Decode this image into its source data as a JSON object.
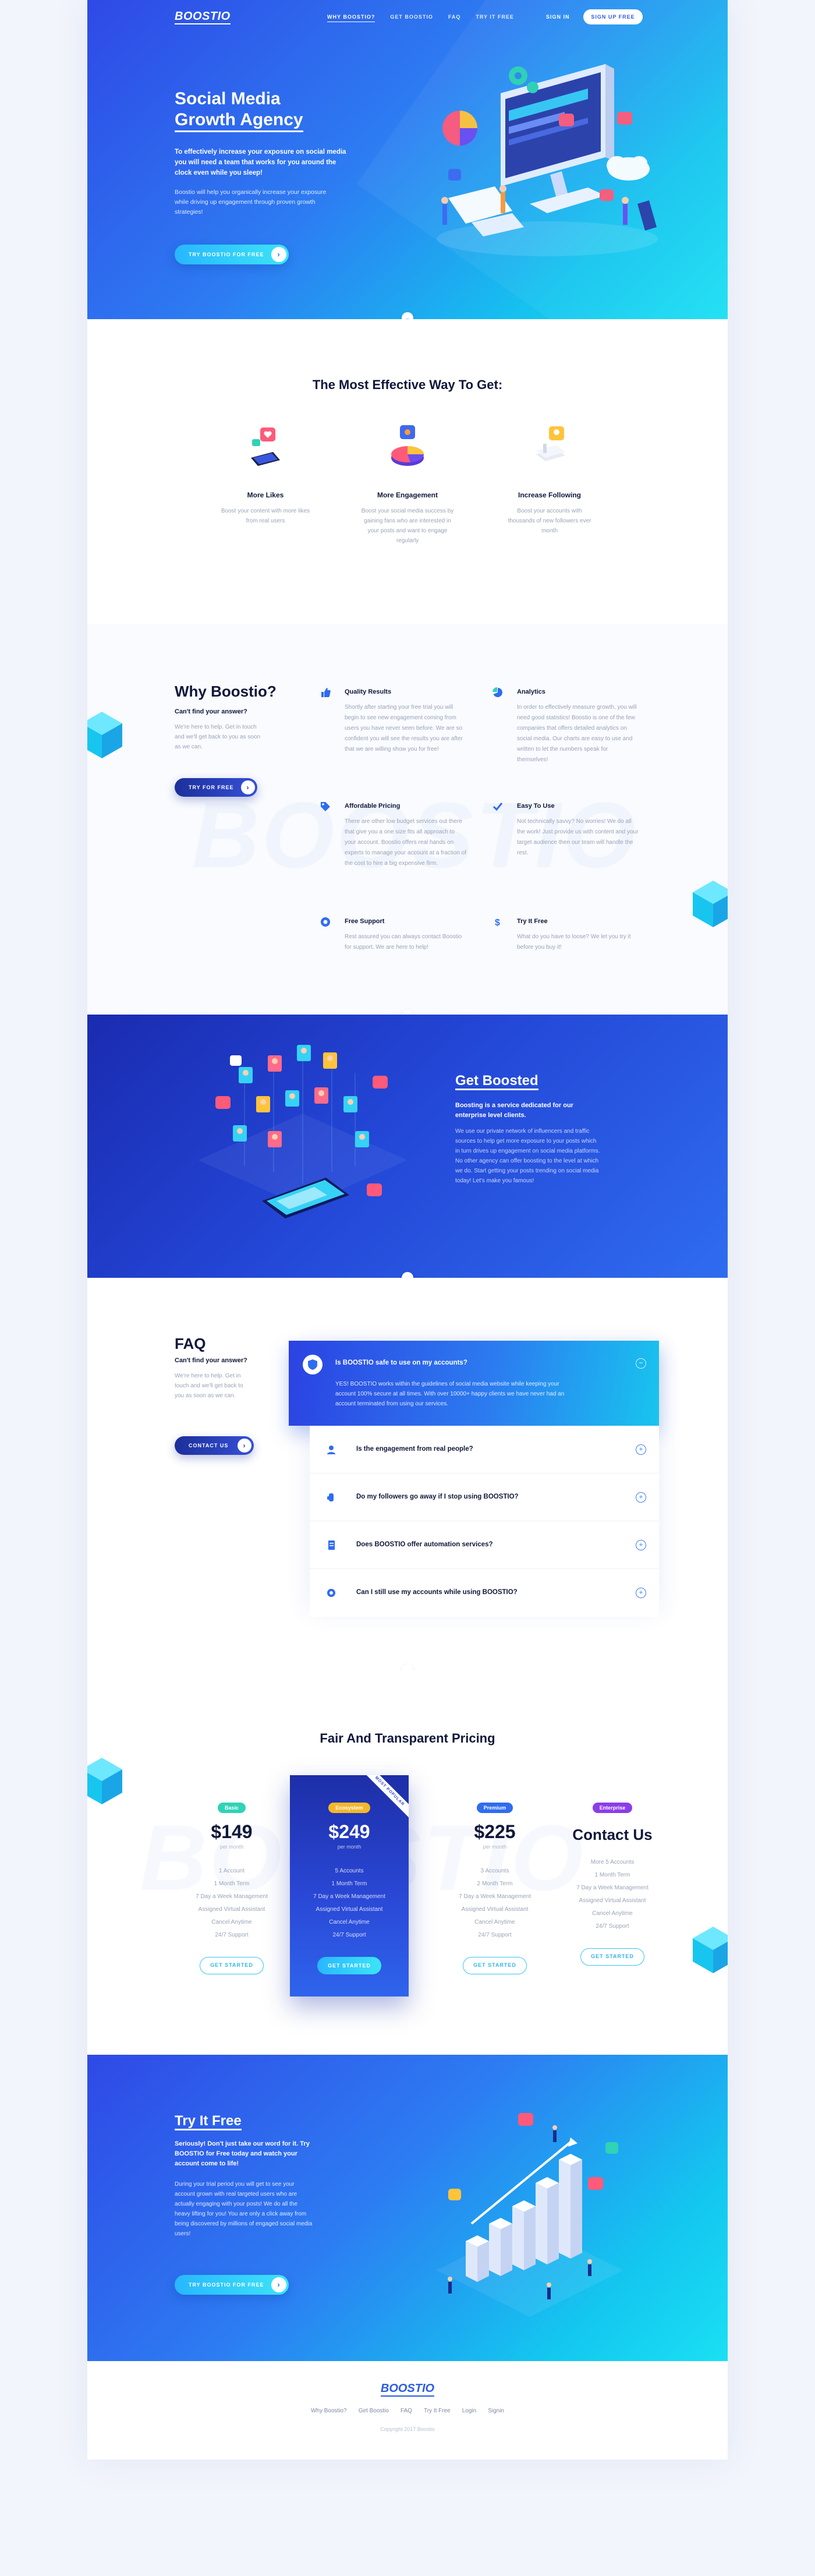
{
  "brand": {
    "logo": "BOOSTIO"
  },
  "nav": {
    "links": [
      "WHY BOOSTIO?",
      "GET BOOSTIO",
      "FAQ",
      "TRY IT FREE"
    ],
    "signin": "SIGN IN",
    "signup": "SIGN UP FREE"
  },
  "hero": {
    "title_line1": "Social Media",
    "title_line2": "Growth Agency",
    "lead": "To effectively increase your exposure on social media you will need a team that works for you around the clock even while you sleep!",
    "sub": "Boostio will help you organically increase your exposure while driving up engagement through proven growth strategies!",
    "cta": "TRY BOOSTIO FOR FREE"
  },
  "effective": {
    "title": "The Most Effective Way To Get:",
    "items": [
      {
        "title": "More Likes",
        "text": "Boost your content with more likes from real users"
      },
      {
        "title": "More Engagement",
        "text": "Boost your social media success by gaining fans who are interested in your posts and want to engage regularly"
      },
      {
        "title": "Increase Following",
        "text": "Boost your accounts with thousands of new followers ever month"
      }
    ]
  },
  "why": {
    "title": "Why Boostio?",
    "subtitle": "Can't find your answer?",
    "text": "We're here to help. Get in touch and we'll get back to you as soon as we can.",
    "cta": "TRY FOR FREE",
    "watermark": "BOOSTIO",
    "features": [
      {
        "title": "Quality Results",
        "text": "Shortly after starting your free trial you will begin to see new engagement coming from users you have never seen before. We are so confident you will see the results you are after that we are willing show you for free!"
      },
      {
        "title": "Analytics",
        "text": "In order to effectively measure growth, you will need good statistics! Boostio is one of the few companies that offers detailed analytics on social media. Our charts are easy to use and written to let the numbers speak for themselves!"
      },
      {
        "title": "Affordable Pricing",
        "text": "There are other low budget services out there that give you a one size fits all approach to your account. Boostio offers real hands on experts to manage your account at a fraction of the cost to hire a big expensive firm."
      },
      {
        "title": "Easy To Use",
        "text": "Not technically savvy? No worries! We do all the work! Just provide us with content and your target audience then our team will handle the rest."
      },
      {
        "title": "Free Support",
        "text": "Rest assured you can always contact Boostio for support. We are here to help!"
      },
      {
        "title": "Try It Free",
        "text": "What do you have to loose? We let you try it before you buy it!"
      }
    ]
  },
  "boosted": {
    "title": "Get Boosted",
    "lead": "Boosting is a service dedicated for our enterprise level clients.",
    "text": "We use our private network of influencers and traffic sources to help get more exposure to your posts which in turn drives up engagement on social media platforms. No other agency can offer boosting to the level at which we do. Start getting your posts trending on social media today! Let's make you famous!"
  },
  "faq": {
    "title": "FAQ",
    "subtitle": "Can't find your answer?",
    "text": "We're here to help. Get in touch and we'll get back to you as soon as we can.",
    "cta": "CONTACT US",
    "open": {
      "question": "Is BOOSTIO safe to use on my accounts?",
      "answer": "YES! BOOSTIO works within the guidelines of social media website while keeping your account 100% secure at all times. With over 10000+ happy clients we have never had an account terminated from using our services."
    },
    "questions": [
      "Is the engagement from real people?",
      "Do my followers go away if I stop using BOOSTIO?",
      "Does BOOSTIO offer automation services?",
      "Can I still use my accounts while using BOOSTIO?"
    ]
  },
  "pricing": {
    "title": "Fair And Transparent Pricing",
    "watermark": "BOOSTIO",
    "plans": [
      {
        "badge": "Basic",
        "price": "$149",
        "per": "per month",
        "features": [
          "1 Account",
          "1 Month Term",
          "7 Day a Week Management",
          "Assigned Virtual Assistant",
          "Cancel Anytime",
          "24/7 Support"
        ],
        "cta": "GET STARTED"
      },
      {
        "badge": "Ecosystem",
        "price": "$249",
        "per": "per month",
        "ribbon": "MOST POPULAR",
        "features": [
          "5 Accounts",
          "1 Month Term",
          "7 Day a Week Management",
          "Assigned Virtual Assistant",
          "Cancel Anytime",
          "24/7 Support"
        ],
        "cta": "GET STARTED"
      },
      {
        "badge": "Premium",
        "price": "$225",
        "per": "per month",
        "features": [
          "3 Accounts",
          "2 Month Term",
          "7 Day a Week Management",
          "Assigned Virtual Assistant",
          "Cancel Anytime",
          "24/7 Support"
        ],
        "cta": "GET STARTED"
      },
      {
        "badge": "Enterprise",
        "price": "Contact Us",
        "features": [
          "More 5 Accounts",
          "1 Month Term",
          "7 Day a Week Management",
          "Assigned Virtual Assistant",
          "Cancel Anytime",
          "24/7 Support"
        ],
        "cta": "GET STARTED"
      }
    ]
  },
  "try": {
    "title": "Try It Free",
    "lead": "Seriously! Don't just take our word for it. Try BOOSTIO for Free today and watch your account come to life!",
    "text": "During your trial period you will get to see your account grown with real targeted users who are actually engaging with your posts! We do all the heavy lifting for you! You are only a click away from being discovered by millions of engaged social media users!",
    "cta": "TRY BOOSTIO FOR FREE"
  },
  "footer": {
    "logo": "BOOSTIO",
    "links": [
      "Why Boostio?",
      "Get Boostio",
      "FAQ",
      "Try It Free",
      "Login",
      "Signin"
    ],
    "copyright": "Copyright 2017 Boostio"
  },
  "colors": {
    "primary": "#2f5be8",
    "cyan": "#14c6ef",
    "navy": "#10183a",
    "badge_basic": "#2fd3b6",
    "badge_ecosystem": "#f5b72a",
    "badge_premium": "#2f6cf0",
    "badge_enterprise": "#8b3de8"
  }
}
